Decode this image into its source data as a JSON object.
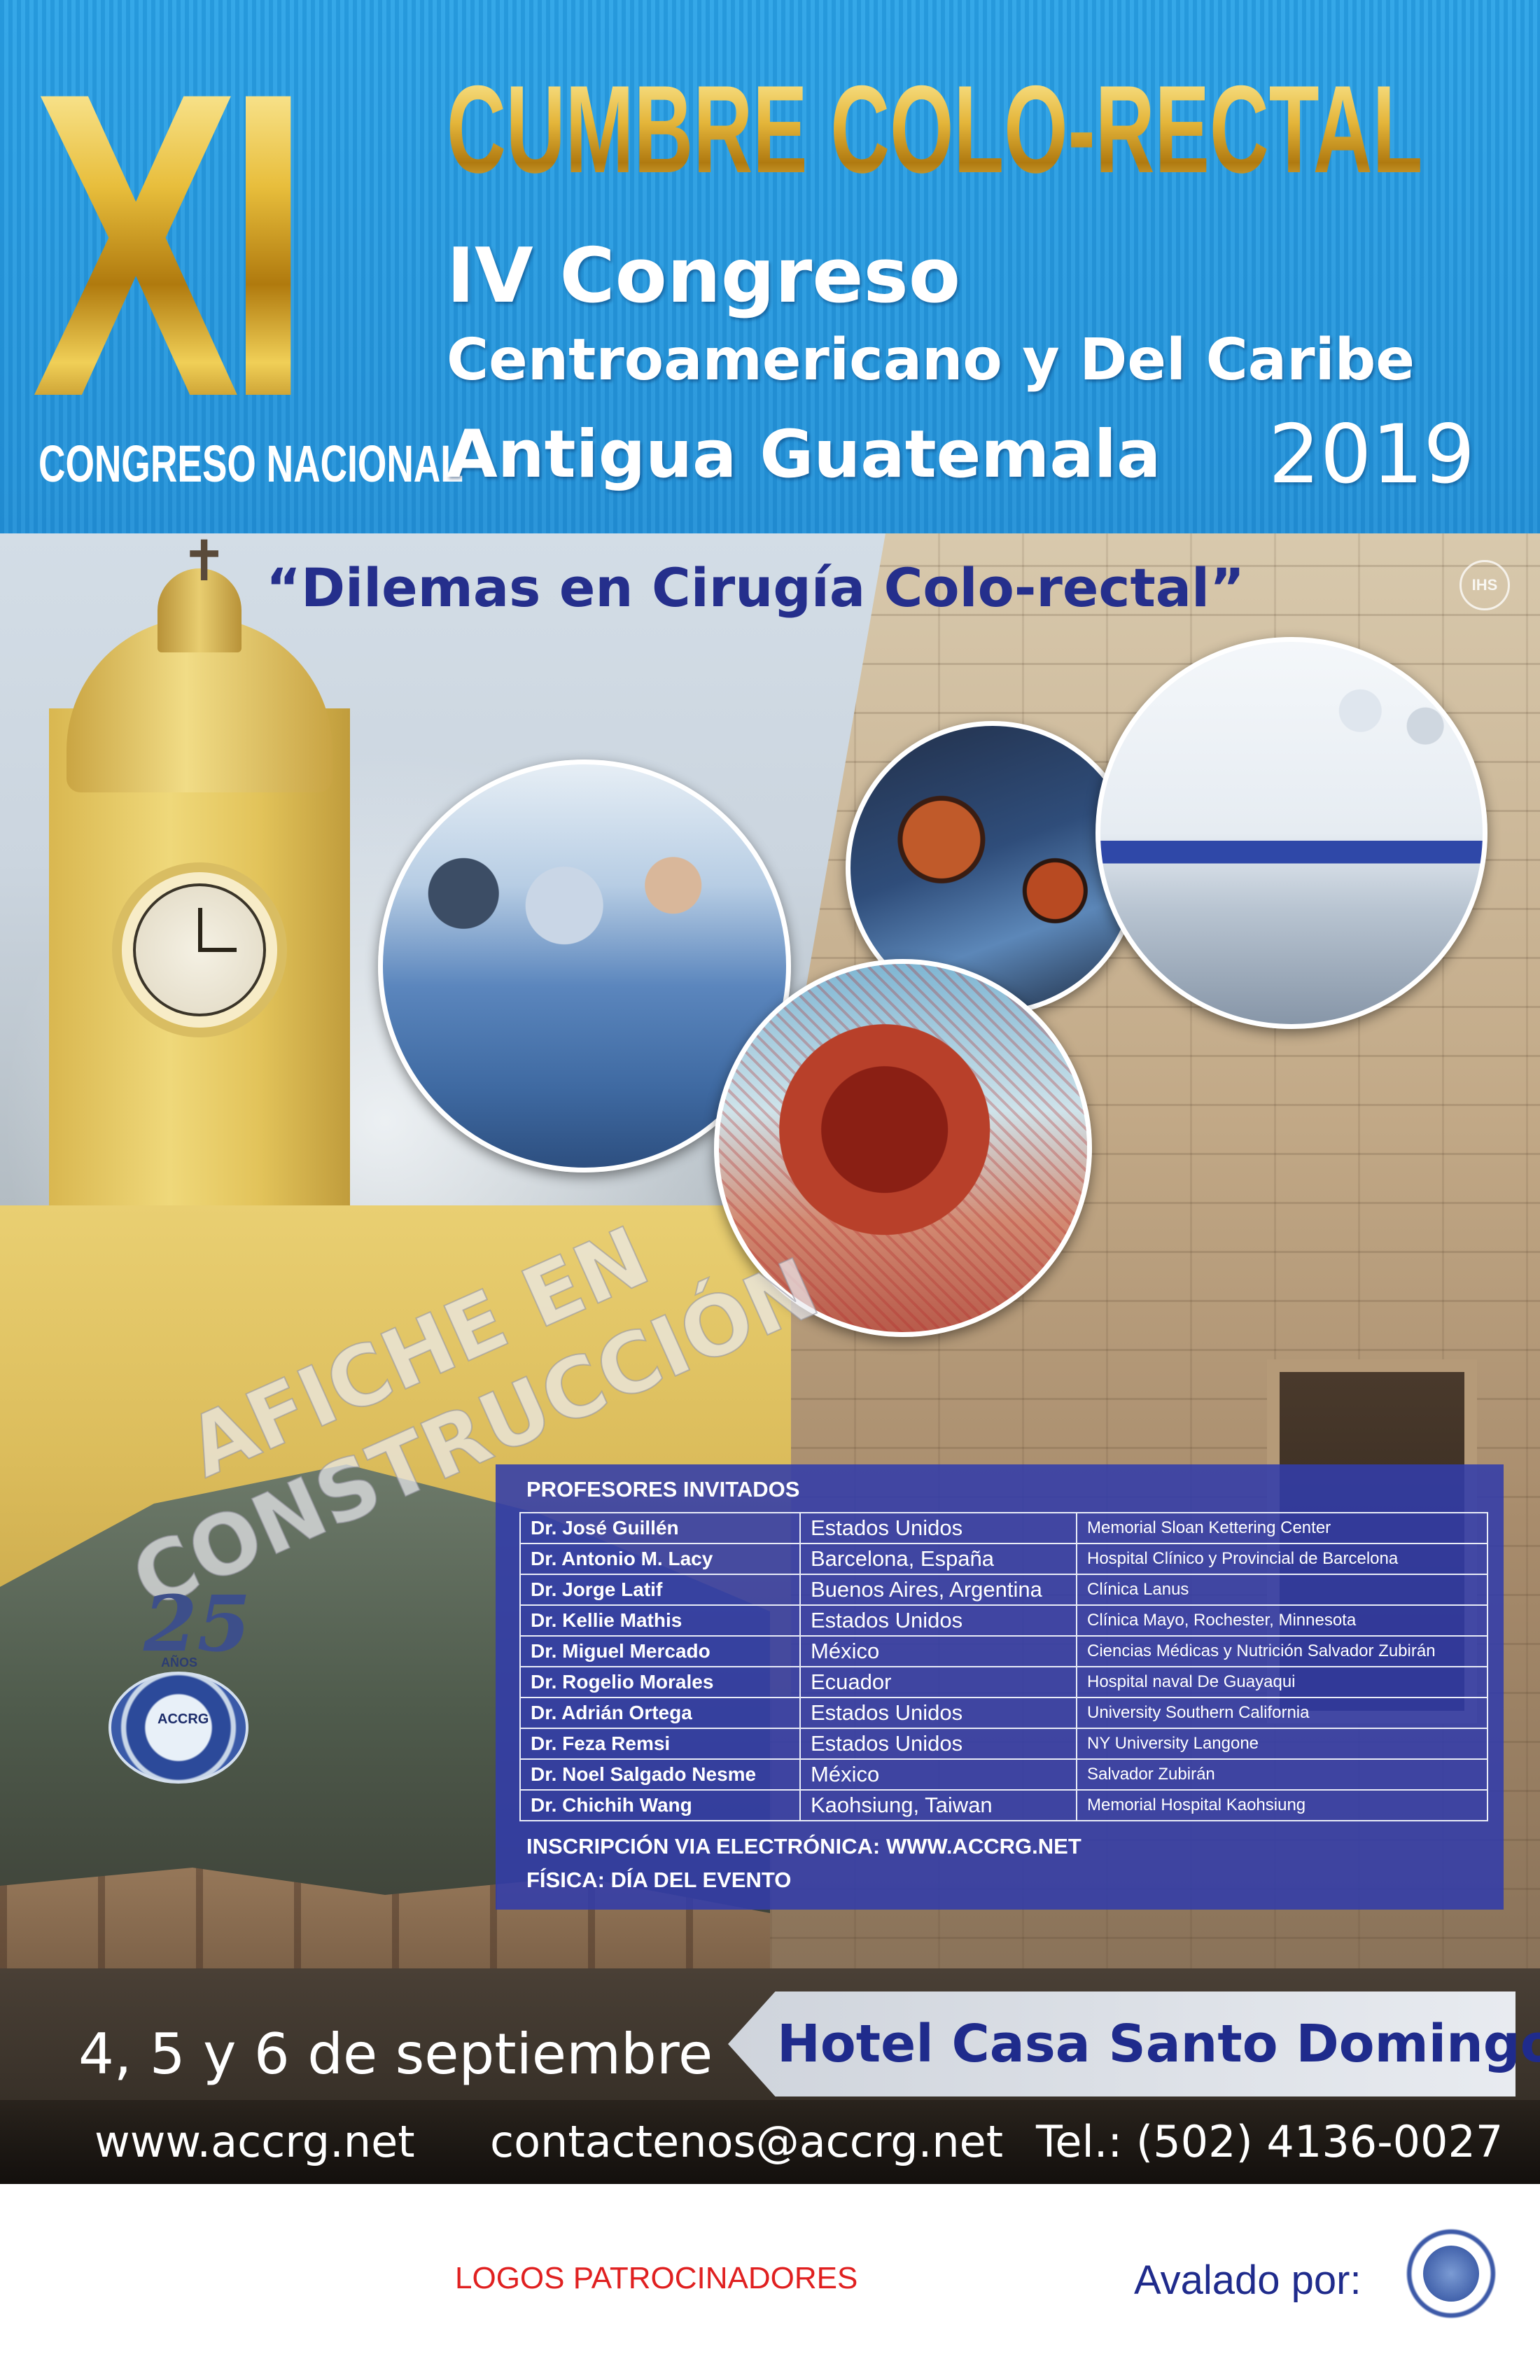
{
  "header": {
    "roman_numeral": "XI",
    "congreso_nacional": "CONGRESO NACIONAL",
    "title": "CUMBRE COLO-RECTAL",
    "line1": "IV Congreso",
    "line2": "Centroamericano y Del Caribe",
    "line3": "Antigua Guatemala",
    "year": "2019"
  },
  "subtitle": "“Dilemas en Cirugía Colo-rectal”",
  "seal_text": "IHS",
  "watermark": {
    "line1": "AFICHE EN",
    "line2": "CONSTRUCCIÓN"
  },
  "logo": {
    "number": "25",
    "anos": "AÑOS",
    "acronym": "ACCRG"
  },
  "professors": {
    "title": "PROFESORES INVITADOS",
    "rows": [
      {
        "name": "Dr. José Guillén",
        "country": "Estados Unidos",
        "institution": "Memorial Sloan Kettering Center"
      },
      {
        "name": "Dr. Antonio M. Lacy",
        "country": "Barcelona, España",
        "institution": "Hospital Clínico y Provincial de Barcelona"
      },
      {
        "name": "Dr. Jorge Latif",
        "country": "Buenos Aires, Argentina",
        "institution": "Clínica Lanus"
      },
      {
        "name": "Dr. Kellie Mathis",
        "country": "Estados Unidos",
        "institution": "Clínica Mayo, Rochester, Minnesota"
      },
      {
        "name": "Dr. Miguel Mercado",
        "country": "México",
        "institution": "Ciencias Médicas y Nutrición Salvador Zubirán"
      },
      {
        "name": "Dr. Rogelio Morales",
        "country": "Ecuador",
        "institution": "Hospital naval De Guayaqui"
      },
      {
        "name": "Dr. Adrián Ortega",
        "country": "Estados Unidos",
        "institution": "University Southern California"
      },
      {
        "name": "Dr. Feza Remsi",
        "country": "Estados Unidos",
        "institution": "NY University Langone"
      },
      {
        "name": "Dr. Noel Salgado Nesme",
        "country": "México",
        "institution": "Salvador Zubirán"
      },
      {
        "name": "Dr. Chichih Wang",
        "country": "Kaohsiung, Taiwan",
        "institution": "Memorial Hospital Kaohsiung"
      }
    ],
    "registration_online": "INSCRIPCIÓN VIA ELECTRÓNICA: WWW.ACCRG.NET",
    "registration_physical": "FÍSICA: DÍA DEL EVENTO"
  },
  "event": {
    "dates": "4, 5 y 6 de septiembre",
    "venue": "Hotel Casa Santo Domingo"
  },
  "contact": {
    "website": "www.accrg.net",
    "email": "contactenos@accrg.net",
    "phone": "Tel.: (502) 4136-0027"
  },
  "footer": {
    "sponsors": "LOGOS PATROCINADORES",
    "endorsed_by": "Avalado por:"
  }
}
